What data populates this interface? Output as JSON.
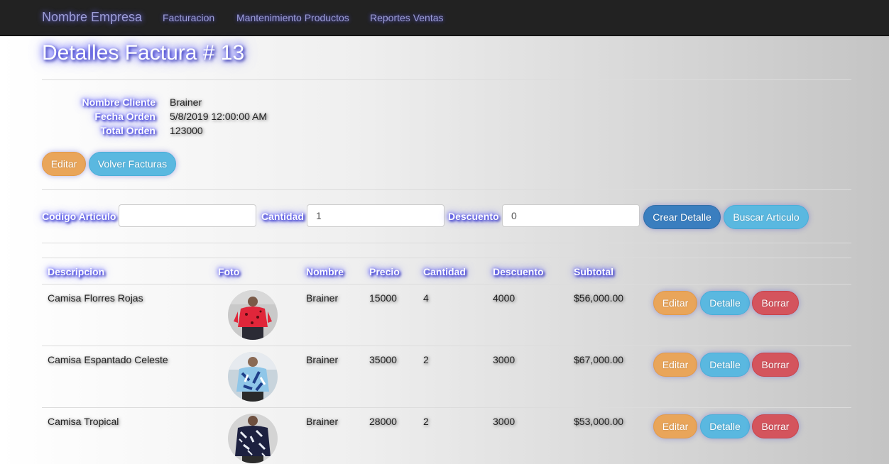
{
  "navbar": {
    "brand": "Nombre Empresa",
    "links": [
      "Facturacion",
      "Mantenimiento Productos",
      "Reportes Ventas"
    ]
  },
  "page": {
    "title": "Detalles Factura # 13"
  },
  "details": {
    "cliente_label": "Nombre Cliente",
    "cliente_value": "Brainer",
    "fecha_label": "Fecha Orden",
    "fecha_value": "5/8/2019 12:00:00 AM",
    "total_label": "Total Orden",
    "total_value": "123000"
  },
  "actions": {
    "editar": "Editar",
    "volver": "Volver Facturas"
  },
  "form": {
    "codigo_label": "Codigo Articulo",
    "codigo_value": "",
    "cantidad_label": "Cantidad",
    "cantidad_value": "1",
    "descuento_label": "Descuento",
    "descuento_value": "0",
    "crear_button": "Crear Detalle",
    "buscar_button": "Buscar Articulo"
  },
  "table": {
    "headers": [
      "Descripcion",
      "Foto",
      "Nombre",
      "Precio",
      "Cantidad",
      "Descuento",
      "Subtotal"
    ],
    "rows": [
      {
        "descripcion": "Camisa Florres Rojas",
        "foto": "red-shirt-photo",
        "nombre": "Brainer",
        "precio": "15000",
        "cantidad": "4",
        "descuento": "4000",
        "subtotal": "$56,000.00",
        "editar": "Editar",
        "detalle": "Detalle",
        "borrar": "Borrar"
      },
      {
        "descripcion": "Camisa Espantado Celeste",
        "foto": "light-blue-shirt-photo",
        "nombre": "Brainer",
        "precio": "35000",
        "cantidad": "2",
        "descuento": "3000",
        "subtotal": "$67,000.00",
        "editar": "Editar",
        "detalle": "Detalle",
        "borrar": "Borrar"
      },
      {
        "descripcion": "Camisa Tropical",
        "foto": "navy-tropical-shirt-photo",
        "nombre": "Brainer",
        "precio": "28000",
        "cantidad": "2",
        "descuento": "3000",
        "subtotal": "$53,000.00",
        "editar": "Editar",
        "detalle": "Detalle",
        "borrar": "Borrar"
      }
    ]
  },
  "colors": {
    "navbar_bg": "#222222",
    "warning": "#e9a55a",
    "info": "#5ab8e0",
    "danger": "#d4545d",
    "primary": "#3a7ebf"
  }
}
